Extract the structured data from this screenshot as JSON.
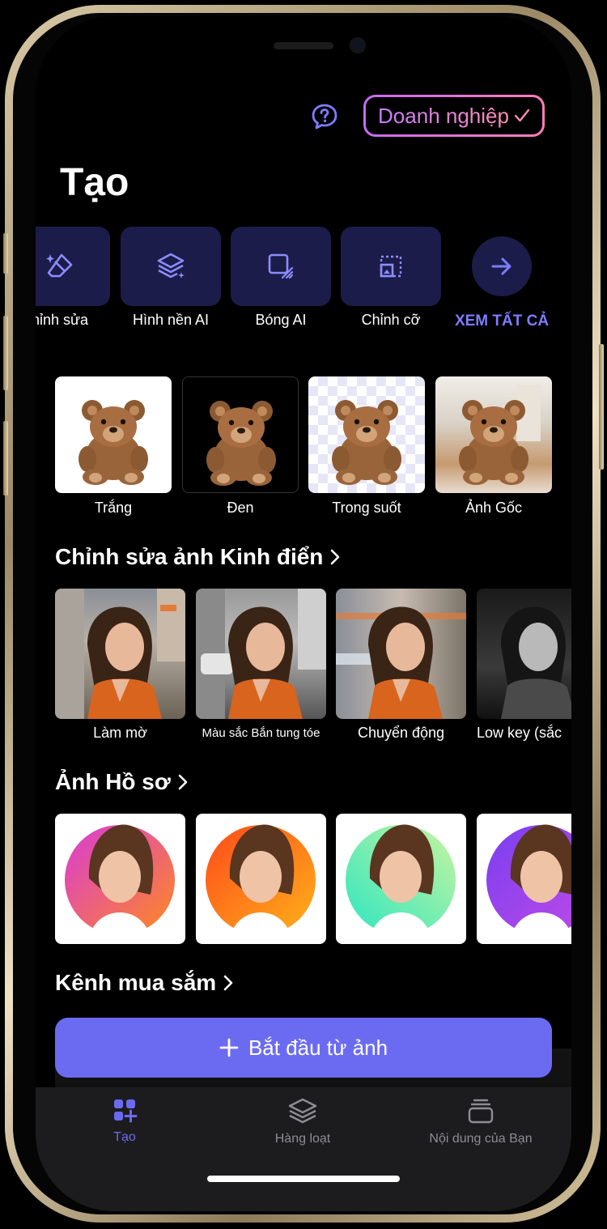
{
  "header": {
    "business_label": "Doanh nghiệp",
    "title": "Tạo"
  },
  "tools": [
    {
      "label": "hỉnh sửa",
      "icon": "eraser-sparkle-icon"
    },
    {
      "label": "Hình nền AI",
      "icon": "layers-sparkle-icon"
    },
    {
      "label": "Bóng AI",
      "icon": "shadow-square-icon"
    },
    {
      "label": "Chỉnh cỡ",
      "icon": "resize-icon"
    }
  ],
  "see_all": {
    "label": "XEM TẤT CẢ",
    "icon": "arrow-right-icon"
  },
  "backgrounds": [
    {
      "label": "Trắng"
    },
    {
      "label": "Đen"
    },
    {
      "label": "Trong suốt"
    },
    {
      "label": "Ảnh Gốc"
    }
  ],
  "sections": {
    "classic": "Chỉnh sửa ảnh Kinh điển",
    "profile": "Ảnh Hồ sơ",
    "shopping": "Kênh mua sắm"
  },
  "classic_edits": [
    {
      "label": "Làm mờ"
    },
    {
      "label": "Màu sắc Bắn tung tóe"
    },
    {
      "label": "Chuyển động"
    },
    {
      "label": "Low key (sắc"
    }
  ],
  "profile_colors": [
    "#f13ea0",
    "#ff7a1a",
    "#3fe0b0",
    "#8a3ff0"
  ],
  "start_button": {
    "label": "Bắt đầu từ ảnh"
  },
  "tabbar": {
    "create": "Tạo",
    "batch": "Hàng loạt",
    "content": "Nội dung của Bạn"
  },
  "colors": {
    "accent": "#6b6bf2",
    "tile": "#1c1c4a",
    "see_all": "#7d7dff"
  }
}
